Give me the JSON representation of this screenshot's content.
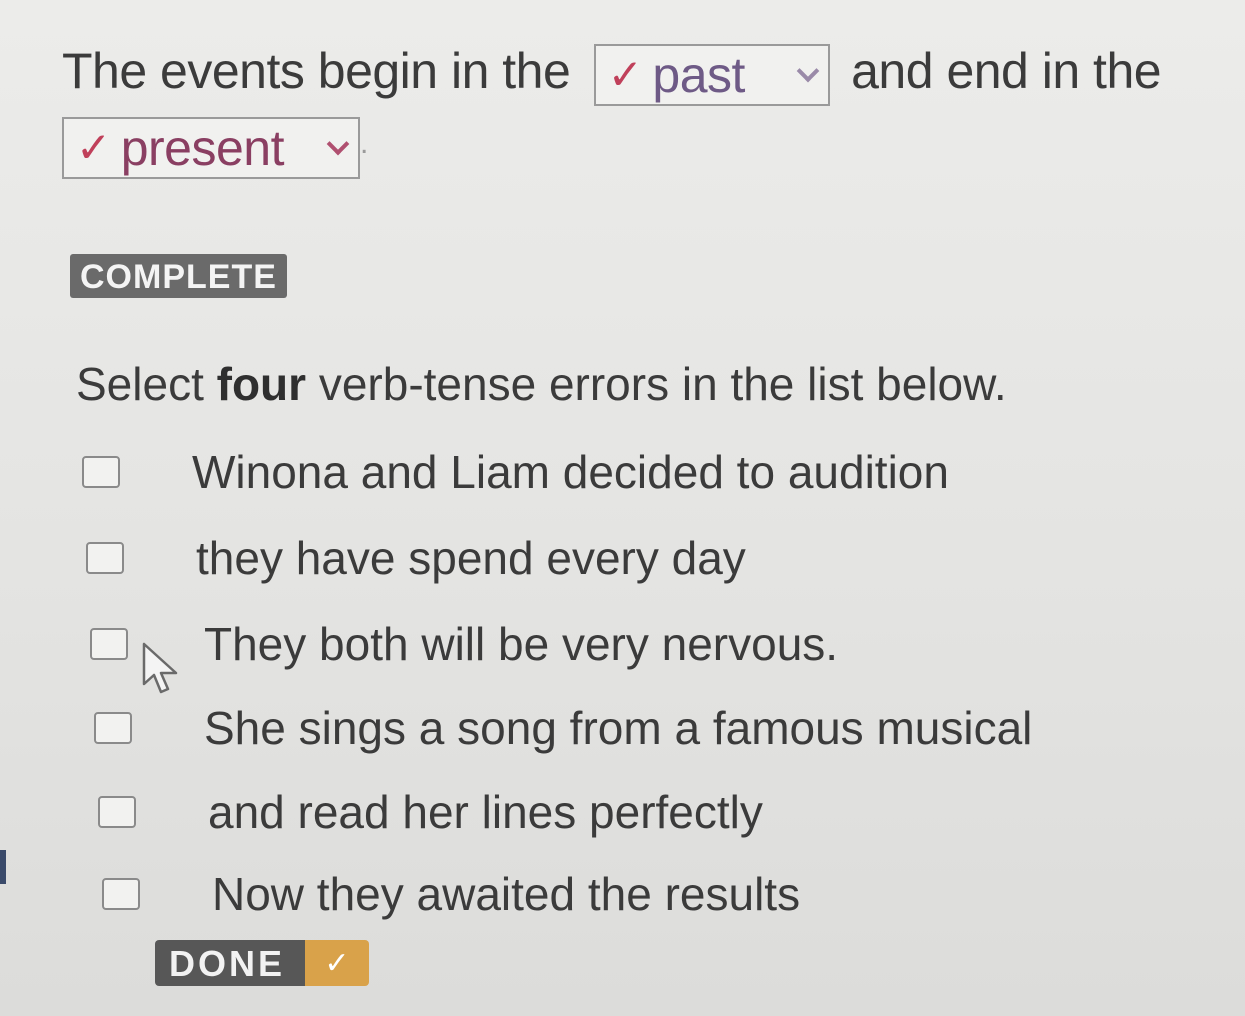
{
  "sentence": {
    "part1": "The events begin in the",
    "part2": "and end in the",
    "period": "."
  },
  "dropdown_past": {
    "check": "✓",
    "value": "past"
  },
  "dropdown_present": {
    "check": "✓",
    "value": "present"
  },
  "badge": "COMPLETE",
  "instruction": {
    "before": "Select ",
    "bold": "four",
    "after": " verb-tense errors in the list below."
  },
  "options": [
    {
      "label": "Winona and Liam decided to audition",
      "checked": false
    },
    {
      "label": "they have spend every day",
      "checked": false
    },
    {
      "label": "They both will be very nervous.",
      "checked": false
    },
    {
      "label": "She sings a song from a famous musical",
      "checked": false
    },
    {
      "label": "and read her lines perfectly",
      "checked": false
    },
    {
      "label": "Now they awaited the results",
      "checked": false
    }
  ],
  "done_button": {
    "label": "DONE",
    "check": "✓"
  },
  "colors": {
    "check_mark": "#c0405a",
    "badge_bg": "#6a6a6a",
    "done_accent": "#d9a24a"
  }
}
